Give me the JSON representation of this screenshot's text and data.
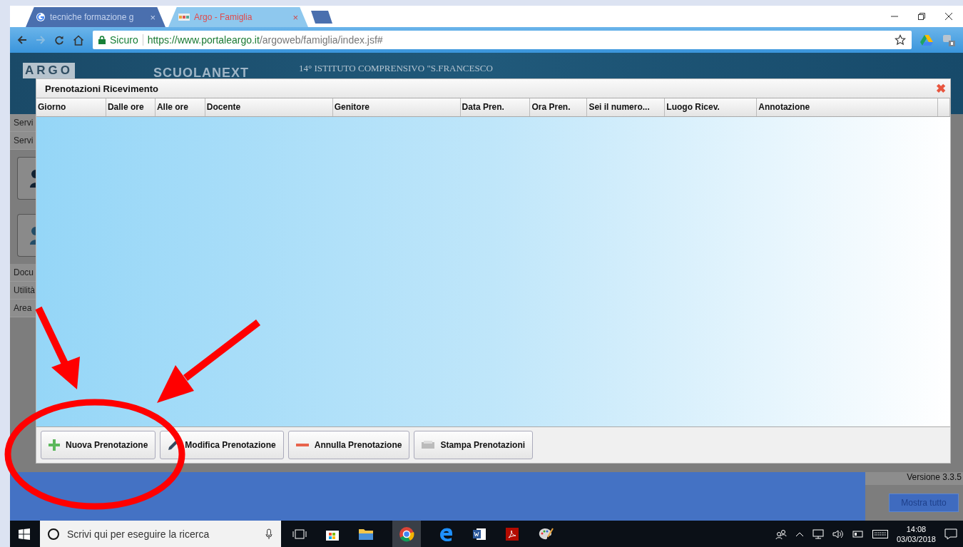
{
  "browser": {
    "tabs": [
      {
        "title": "tecniche formazione g",
        "selected": false,
        "close": "×"
      },
      {
        "title": "Argo - Famiglia",
        "selected": true,
        "close": "×"
      }
    ],
    "security": "Sicuro",
    "url_host": "https://www.portaleargo.it",
    "url_path": "/argoweb/famiglia/index.jsf#"
  },
  "app": {
    "logo": "ARGO",
    "product": "SCUOLANEXT",
    "school": "14° ISTITUTO COMPRENSIVO \"S.FRANCESCO",
    "sidebar": [
      "Servi",
      "Servi",
      "Docu",
      "Utilità",
      "Area"
    ],
    "version": "Versione 3.3.5"
  },
  "dialog": {
    "title": "Prenotazioni Ricevimento",
    "close": "✖",
    "columns": [
      "Giorno",
      "Dalle ore",
      "Alle ore",
      "Docente",
      "Genitore",
      "Data Pren.",
      "Ora Pren.",
      "Sei il numero...",
      "Luogo Ricev.",
      "Annotazione"
    ],
    "buttons": [
      {
        "label": "Nuova Prenotazione",
        "kind": "add"
      },
      {
        "label": "Modifica Prenotazione",
        "kind": "edit"
      },
      {
        "label": "Annulla Prenotazione",
        "kind": "remove"
      },
      {
        "label": "Stampa Prenotazioni",
        "kind": "print"
      }
    ]
  },
  "notification_bar": {
    "button": "Mostra tutto"
  },
  "taskbar": {
    "search_placeholder": "Scrivi qui per eseguire la ricerca",
    "time": "14:08",
    "date": "03/03/2018"
  }
}
